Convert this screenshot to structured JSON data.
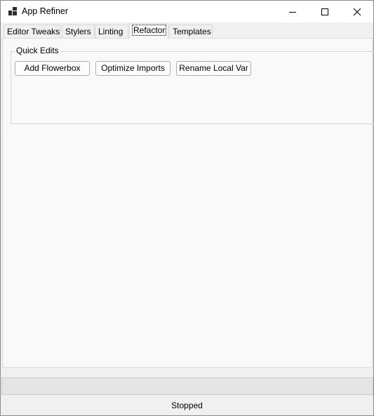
{
  "window": {
    "title": "App Refiner",
    "icons": {
      "app": "app-window-icon",
      "minimize": "minimize-icon",
      "maximize": "maximize-icon",
      "close": "close-icon"
    }
  },
  "tabs": [
    {
      "label": "Editor Tweaks",
      "active": false
    },
    {
      "label": "Stylers",
      "active": false
    },
    {
      "label": "Linting",
      "active": false
    },
    {
      "label": "Refactor",
      "active": true
    },
    {
      "label": "Templates",
      "active": false
    }
  ],
  "refactor": {
    "group_title": "Quick Edits",
    "buttons": {
      "flowerbox": "Add Flowerbox",
      "imports": "Optimize Imports",
      "rename": "Rename Local Var"
    }
  },
  "status": {
    "text": "Stopped"
  },
  "colors": {
    "window_bg": "#f0f0f0",
    "tab_page_bg": "#f9f9f9",
    "button_border": "#adadad"
  }
}
